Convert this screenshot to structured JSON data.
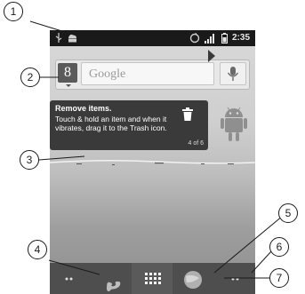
{
  "status_bar": {
    "time": "2:35",
    "icons": [
      "usb-icon",
      "android-debug-icon",
      "sync-icon",
      "signal-icon",
      "battery-icon"
    ]
  },
  "search_widget": {
    "logo": "8",
    "placeholder": "Google",
    "mic_icon": "microphone-icon"
  },
  "tip": {
    "title": "Remove items.",
    "body": "Touch & hold an item and when it vibrates, drag it to the Trash icon.",
    "count": "4 of 6",
    "icon": "trash-icon"
  },
  "dock": {
    "items": [
      "launcher-dots-left-icon",
      "phone-icon",
      "app-drawer-icon",
      "browser-icon",
      "launcher-dots-right-icon"
    ]
  },
  "callouts": [
    "1",
    "2",
    "3",
    "4",
    "5",
    "6",
    "7"
  ],
  "colors": {
    "status_bar": "#1a1a1a",
    "dock": "#4e4e4e",
    "tip_bg": "#3a3a3a",
    "android_green": "#8f8f8f"
  }
}
